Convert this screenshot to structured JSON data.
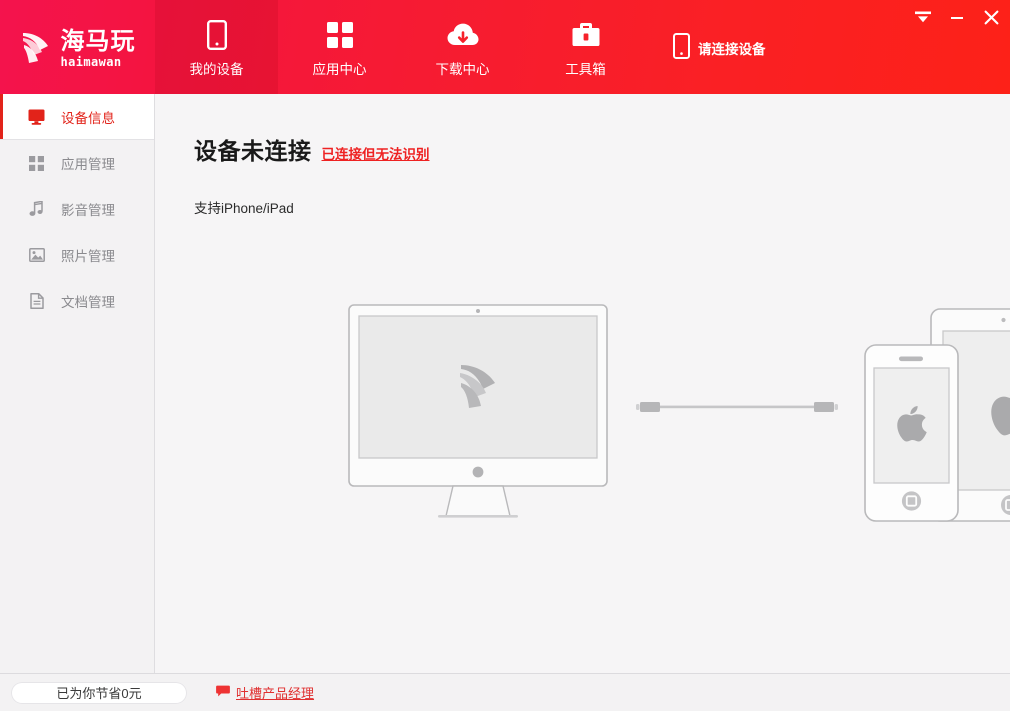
{
  "window": {
    "controls": [
      {
        "name": "menu",
        "label": "▼"
      },
      {
        "name": "minimize",
        "label": "—"
      },
      {
        "name": "close",
        "label": "✕"
      }
    ]
  },
  "brand": {
    "cn": "海马玩",
    "en": "haimawan",
    "mark": "seahorse-logo-icon",
    "accent": "#f4134d"
  },
  "header": {
    "gradient_from": "#f4134d",
    "gradient_to": "#fd2118",
    "nav": [
      {
        "label": "我的设备",
        "icon": "phone-icon",
        "active": true
      },
      {
        "label": "应用中心",
        "icon": "grid-icon",
        "active": false
      },
      {
        "label": "下载中心",
        "icon": "cloud-download-icon",
        "active": false
      },
      {
        "label": "工具箱",
        "icon": "briefcase-icon",
        "active": false
      }
    ],
    "device_status": {
      "label": "请连接设备",
      "icon": "phone-icon"
    }
  },
  "sidebar": {
    "items": [
      {
        "label": "设备信息",
        "icon": "monitor-icon",
        "active": true
      },
      {
        "label": "应用管理",
        "icon": "grid-icon",
        "active": false
      },
      {
        "label": "影音管理",
        "icon": "music-note-icon",
        "active": false
      },
      {
        "label": "照片管理",
        "icon": "photo-icon",
        "active": false
      },
      {
        "label": "文档管理",
        "icon": "document-icon",
        "active": false
      }
    ]
  },
  "main": {
    "headline": "设备未连接",
    "headline_link": "已连接但无法识别",
    "subline": "支持iPhone/iPad",
    "illustration": {
      "computer": "imac-with-haimawan-logo",
      "cable": "usb-cable",
      "devices": "iphone-and-ipad"
    }
  },
  "footer": {
    "saved_label": "已为你节省0元",
    "feedback_label": "吐槽产品经理",
    "feedback_icon": "speech-bubble-icon",
    "link_color": "#e03030"
  }
}
